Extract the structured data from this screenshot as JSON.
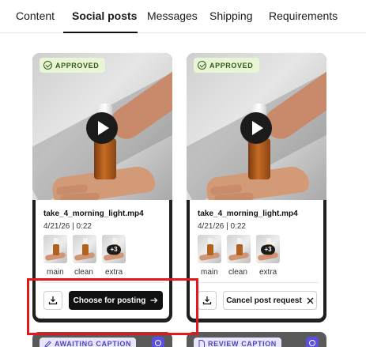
{
  "tabs": [
    {
      "label": "Content"
    },
    {
      "label": "Social posts",
      "active": true
    },
    {
      "label": "Messages"
    },
    {
      "label": "Shipping"
    },
    {
      "label": "Requirements"
    }
  ],
  "cards": [
    {
      "status_badge": "APPROVED",
      "file_name": "take_4_morning_light.mp4",
      "meta": "4/21/26 | 0:22",
      "thumbnails": [
        {
          "label": "main"
        },
        {
          "label": "clean"
        },
        {
          "label": "extra",
          "more_badge": "+3"
        }
      ],
      "primary_action": "Choose for posting",
      "primary_action_icon": "arrow-right-icon"
    },
    {
      "status_badge": "APPROVED",
      "file_name": "take_4_morning_light.mp4",
      "meta": "4/21/26 | 0:22",
      "thumbnails": [
        {
          "label": "main"
        },
        {
          "label": "clean"
        },
        {
          "label": "extra",
          "more_badge": "+3"
        }
      ],
      "secondary_action": "Cancel post request",
      "secondary_action_icon": "close-icon"
    }
  ],
  "lower_cards": [
    {
      "status_badge": "AWAITING CAPTION",
      "icon": "edit-icon",
      "platform_icon": "instagram-icon"
    },
    {
      "status_badge": "REVIEW CAPTION",
      "icon": "document-icon",
      "platform_icon": "instagram-icon"
    }
  ],
  "colors": {
    "approved_bg": "#e8f6d6",
    "approved_text": "#2e5a1c",
    "caption_badge_bg": "#e7e6fb",
    "caption_badge_text": "#4b44b8",
    "highlight": "#e4171b"
  }
}
